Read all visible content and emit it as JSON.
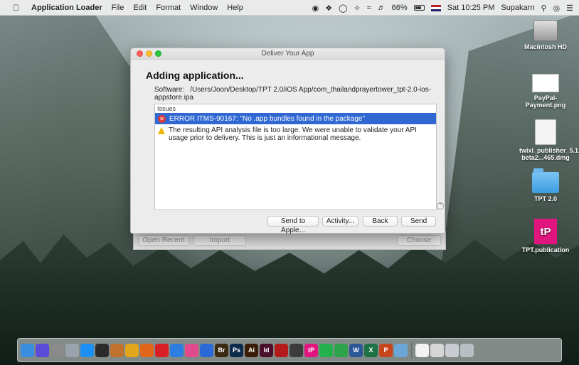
{
  "menubar": {
    "app_name": "Application Loader",
    "menus": [
      "File",
      "Edit",
      "Format",
      "Window",
      "Help"
    ],
    "battery_percent": "66%",
    "clock": "Sat 10:25 PM",
    "user": "Supakarn"
  },
  "desktop": {
    "icons": [
      {
        "label": "Macintosh HD",
        "icon": "hard-drive-icon"
      },
      {
        "label": "PayPal-Payment.png",
        "icon": "image-file-icon"
      },
      {
        "label": "twixl_publisher_5.1.1-beta2...465.dmg",
        "icon": "disk-image-icon"
      },
      {
        "label": "TPT 2.0",
        "icon": "folder-icon"
      },
      {
        "label": "TPT.publication",
        "icon": "publication-icon",
        "badge": "tP"
      }
    ]
  },
  "back_window": {
    "open_recent": "Open Recent",
    "import": "Import",
    "choose": "Choose"
  },
  "dialog": {
    "title": "Deliver Your App",
    "heading": "Adding application...",
    "software_label": "Software:",
    "software_path": "/Users/Joon/Desktop/TPT 2.0/iOS App/com_thailandprayertower_tpt-2.0-ios-appstore.ipa",
    "issues_header": "Issues",
    "issues": [
      {
        "type": "error",
        "text": "ERROR ITMS-90167: \"No .app bundles found in the package\"",
        "selected": true
      },
      {
        "type": "warning",
        "text": "The resulting API analysis file is too large.  We were unable to validate your API usage prior to delivery.  This is just an informational message.",
        "selected": false
      }
    ],
    "buttons": {
      "send_to_apple": "Send to Apple...",
      "activity": "Activity...",
      "back": "Back",
      "send": "Send"
    }
  },
  "dock": {
    "apps": [
      {
        "name": "finder-icon",
        "color": "#3b8de0",
        "label": ""
      },
      {
        "name": "siri-icon",
        "color": "#5b4bd9",
        "label": ""
      },
      {
        "name": "system-preferences-icon",
        "color": "#8a8a8a",
        "label": ""
      },
      {
        "name": "launchpad-icon",
        "color": "#9aa3ad",
        "label": ""
      },
      {
        "name": "app-store-icon",
        "color": "#1b8ff2",
        "label": ""
      },
      {
        "name": "terminal-icon",
        "color": "#2b2b2b",
        "label": ""
      },
      {
        "name": "books-icon",
        "color": "#c0712e",
        "label": ""
      },
      {
        "name": "chrome-icon",
        "color": "#e2a51c",
        "label": ""
      },
      {
        "name": "firefox-icon",
        "color": "#e0661b",
        "label": ""
      },
      {
        "name": "opera-icon",
        "color": "#d81f26",
        "label": ""
      },
      {
        "name": "safari-icon",
        "color": "#2e7de0",
        "label": ""
      },
      {
        "name": "itunes-icon",
        "color": "#e14a8c",
        "label": ""
      },
      {
        "name": "firefox-dev-icon",
        "color": "#2b6ad6",
        "label": ""
      },
      {
        "name": "bridge-icon",
        "color": "#3a2a12",
        "label": "Br"
      },
      {
        "name": "photoshop-icon",
        "color": "#0c2a4a",
        "label": "Ps"
      },
      {
        "name": "illustrator-icon",
        "color": "#3a1c06",
        "label": "Ai"
      },
      {
        "name": "indesign-icon",
        "color": "#4a0f2a",
        "label": "Id"
      },
      {
        "name": "acrobat-icon",
        "color": "#b41a1a",
        "label": ""
      },
      {
        "name": "sequel-pro-icon",
        "color": "#3c3c3c",
        "label": ""
      },
      {
        "name": "twixl-icon",
        "color": "#e0157e",
        "label": "tP"
      },
      {
        "name": "line-icon",
        "color": "#22b14c",
        "label": ""
      },
      {
        "name": "evernote-icon",
        "color": "#2da44a",
        "label": ""
      },
      {
        "name": "word-icon",
        "color": "#2b5797",
        "label": "W"
      },
      {
        "name": "excel-icon",
        "color": "#1e7145",
        "label": "X"
      },
      {
        "name": "powerpoint-icon",
        "color": "#c7451d",
        "label": "P"
      },
      {
        "name": "preview-icon",
        "color": "#6aa6d8",
        "label": ""
      },
      {
        "name": "separator",
        "color": "",
        "label": ""
      },
      {
        "name": "document-icon",
        "color": "#f2f2f2",
        "label": ""
      },
      {
        "name": "pictures-stack-icon",
        "color": "#d6d6d6",
        "label": ""
      },
      {
        "name": "downloads-stack-icon",
        "color": "#c9ccd0",
        "label": ""
      },
      {
        "name": "trash-icon",
        "color": "#b8bfc4",
        "label": ""
      }
    ]
  }
}
